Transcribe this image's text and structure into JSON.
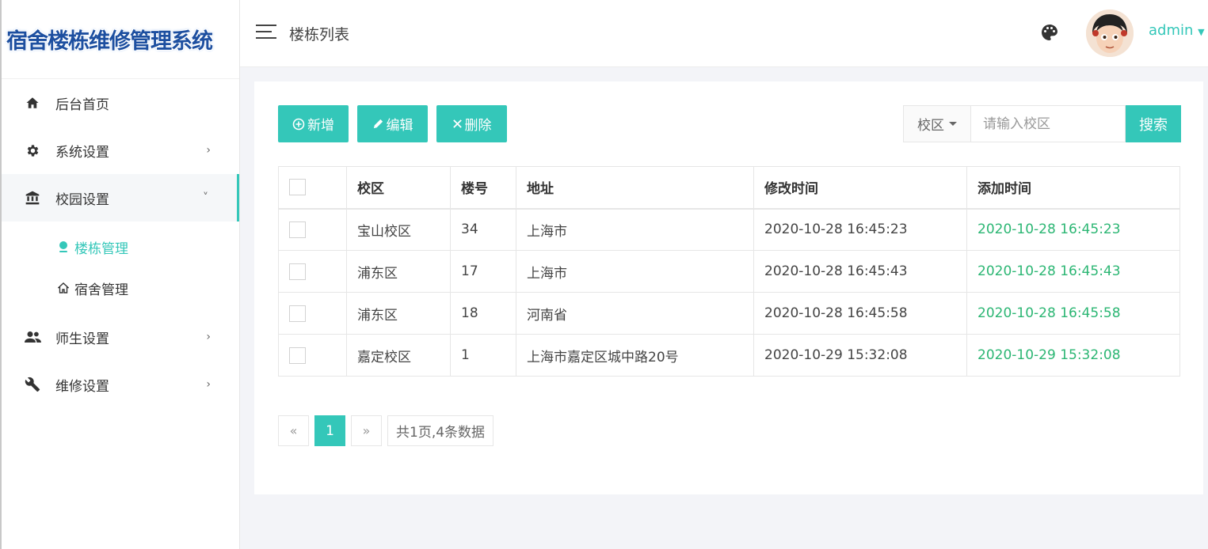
{
  "app": {
    "title": "宿舍楼栋维修管理系统"
  },
  "sidebar": {
    "items": [
      {
        "label": "后台首页",
        "icon": "home-icon"
      },
      {
        "label": "系统设置",
        "icon": "gear-icon"
      },
      {
        "label": "校园设置",
        "icon": "bank-icon"
      },
      {
        "label": "师生设置",
        "icon": "users-icon"
      },
      {
        "label": "维修设置",
        "icon": "wrench-icon"
      }
    ],
    "sub": [
      {
        "label": "楼栋管理",
        "icon": "location-icon"
      },
      {
        "label": "宿舍管理",
        "icon": "house-icon"
      }
    ]
  },
  "header": {
    "title": "楼栋列表",
    "user": "admin"
  },
  "toolbar": {
    "add": "新增",
    "edit": "编辑",
    "del": "删除"
  },
  "search": {
    "field": "校区",
    "placeholder": "请输入校区",
    "button": "搜索"
  },
  "table": {
    "headers": [
      "校区",
      "楼号",
      "地址",
      "修改时间",
      "添加时间"
    ],
    "rows": [
      [
        "宝山校区",
        "34",
        "上海市",
        "2020-10-28 16:45:23",
        "2020-10-28 16:45:23"
      ],
      [
        "浦东区",
        "17",
        "上海市",
        "2020-10-28 16:45:43",
        "2020-10-28 16:45:43"
      ],
      [
        "浦东区",
        "18",
        "河南省",
        "2020-10-28 16:45:58",
        "2020-10-28 16:45:58"
      ],
      [
        "嘉定校区",
        "1",
        "上海市嘉定区城中路20号",
        "2020-10-29 15:32:08",
        "2020-10-29 15:32:08"
      ]
    ]
  },
  "pager": {
    "prev": "«",
    "current": "1",
    "next": "»",
    "info": "共1页,4条数据"
  },
  "colors": {
    "accent": "#34c7b9",
    "added_time": "#2bb673"
  }
}
